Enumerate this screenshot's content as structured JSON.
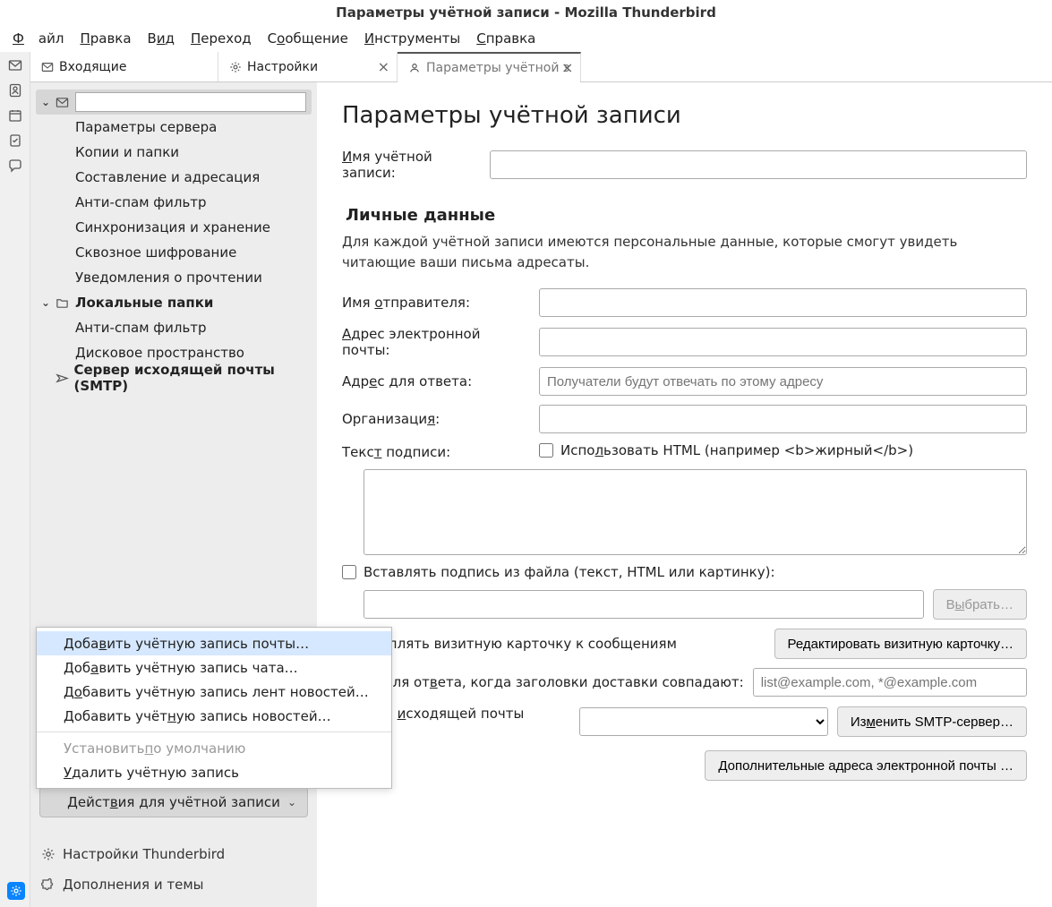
{
  "window": {
    "title": "Параметры учётной записи - Mozilla Thunderbird"
  },
  "menubar": {
    "file": "Файл",
    "edit": "Правка",
    "view": "Вид",
    "go": "Переход",
    "message": "Сообщение",
    "tools": "Инструменты",
    "help": "Справка"
  },
  "tabs": {
    "inbox": "Входящие",
    "settings": "Настройки",
    "account": "Параметры учётной з"
  },
  "sidebar_tree": {
    "server_settings": "Параметры сервера",
    "copies_folders": "Копии и папки",
    "composition": "Составление и адресация",
    "junk": "Анти-спам фильтр",
    "sync": "Синхронизация и хранение",
    "e2e": "Сквозное шифрование",
    "read_receipts": "Уведомления о прочтении",
    "local_folders": "Локальные папки",
    "junk2": "Анти-спам фильтр",
    "disk": "Дисковое пространство",
    "smtp": "Сервер исходящей почты (SMTP)"
  },
  "sidebar_bottom": {
    "actions_button": "Действия для учётной записи",
    "tb_settings": "Настройки Thunderbird",
    "addons": "Дополнения и темы"
  },
  "popup": {
    "add_mail": "Добавить учётную запись почты…",
    "add_chat": "Добавить учётную запись чата…",
    "add_feed": "Добавить учётную запись лент новостей…",
    "add_news": "Добавить учётную запись новостей…",
    "set_default": "Установить по умолчанию",
    "delete": "Удалить учётную запись"
  },
  "main": {
    "heading": "Параметры учётной записи",
    "account_name_label": "Имя учётной записи:",
    "personal_heading": "Личные данные",
    "personal_desc": "Для каждой учётной записи имеются персональные данные, которые смогут увидеть читающие ваши письма адресаты.",
    "sender_name": "Имя отправителя:",
    "email": "Адрес электронной почты:",
    "reply_to": "Адрес для ответа:",
    "reply_to_placeholder": "Получатели будут отвечать по этому адресу",
    "org": "Организация:",
    "sig_label": "Текст подписи:",
    "use_html": "Использовать HTML (например <b>жирный</b>)",
    "sig_file": "Вставлять подпись из файла (текст, HTML или картинку):",
    "browse": "Выбрать…",
    "vcard_attach": "креплять визитную карточку к сообщениям",
    "vcard_edit": "Редактировать визитную карточку…",
    "reply_match": "ес для ответа, когда заголовки доставки совпадают:",
    "reply_match_placeholder": "list@example.com, *@example.com",
    "smtp_label": "Сервер исходящей почты (SMTP)",
    "smtp_edit": "Изменить SMTP-сервер…",
    "more_addresses": "Дополнительные адреса электронной почты …"
  }
}
